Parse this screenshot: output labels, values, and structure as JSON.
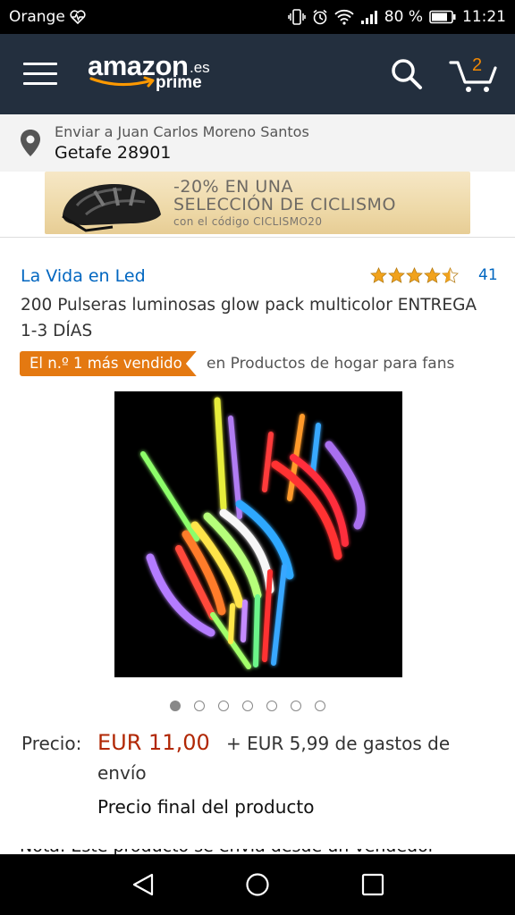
{
  "status_bar": {
    "carrier": "Orange",
    "battery": "80 %",
    "time": "11:21",
    "icons": [
      "heart-monitor-icon",
      "vibrate-icon",
      "alarm-icon",
      "wifi-icon",
      "signal-icon",
      "battery-icon"
    ]
  },
  "header": {
    "logo_main": "amazon",
    "logo_tld": ".es",
    "logo_sub": "prime",
    "cart_count": "2",
    "icons": [
      "menu-icon",
      "search-icon",
      "cart-icon"
    ]
  },
  "delivery": {
    "label": "Enviar a Juan Carlos Moreno Santos",
    "location": "Getafe 28901",
    "icon": "location-pin-icon"
  },
  "banner": {
    "line1": "-20% EN UNA",
    "line2": "SELECCIÓN DE CICLISMO",
    "line3": "con el código CICLISMO20"
  },
  "product": {
    "brand": "La Vida en Led",
    "rating_value": 4.5,
    "rating_count": "41",
    "title": "200 Pulseras luminosas glow pack multicolor ENTREGA 1-3 DÍAS",
    "best_seller_badge": "El n.º 1 más vendido",
    "best_seller_category": "en Productos de hogar para fans",
    "image_count": 7,
    "active_image": 1
  },
  "price": {
    "label": "Precio:",
    "value": "EUR 11,00",
    "shipping": "+ EUR 5,99 de gastos de",
    "shipping_cont": "envío",
    "final_note": "Precio final del producto",
    "cut_off_text": "Nota: Este producto se envía desde un vendedor"
  },
  "colors": {
    "header_bg": "#232f3e",
    "accent_orange": "#e47911",
    "link_blue": "#0066c0",
    "price_red": "#b12704",
    "star": "#f1a21c"
  },
  "nav_bar": {
    "icons": [
      "back-icon",
      "home-icon",
      "recents-icon"
    ]
  }
}
